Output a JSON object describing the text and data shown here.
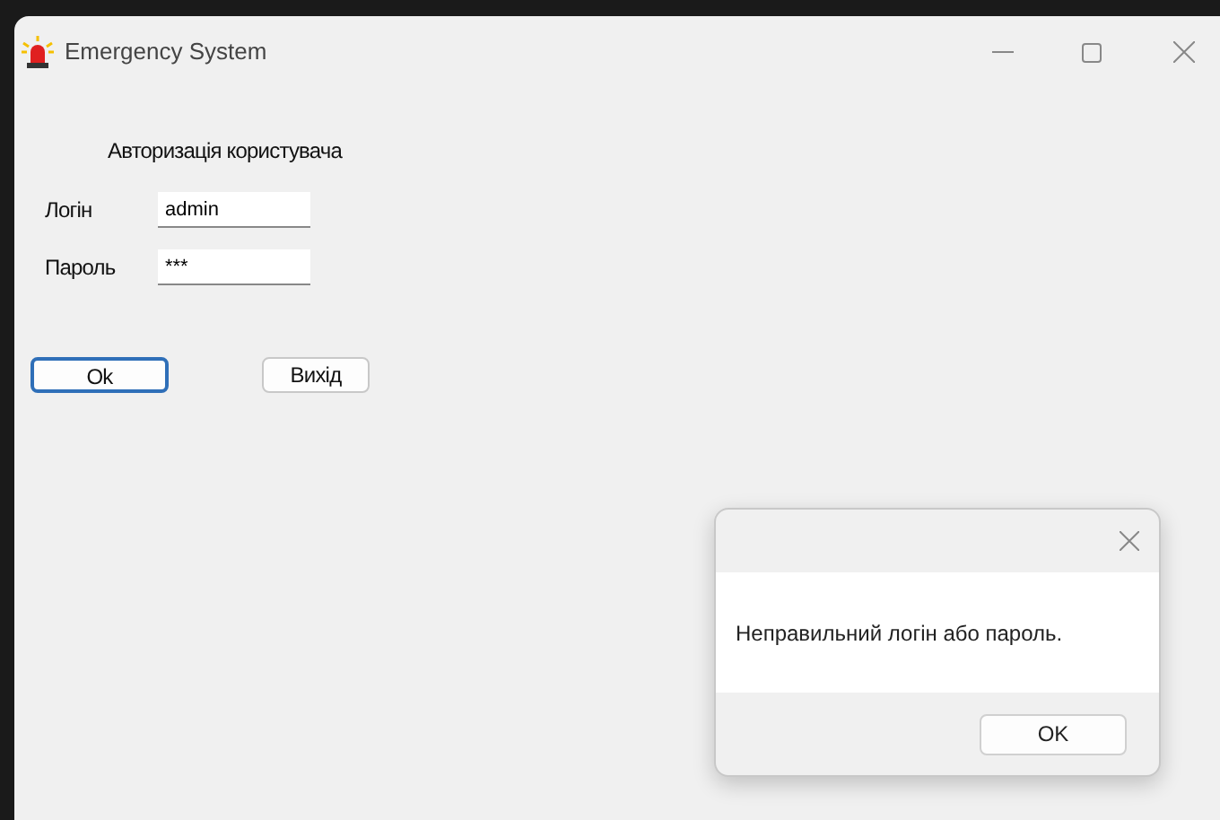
{
  "window": {
    "title": "Emergency System"
  },
  "form": {
    "heading": "Авторизація користувача",
    "fields": [
      {
        "label": "Логін",
        "value": "admin"
      },
      {
        "label": "Пароль",
        "value": "***"
      }
    ],
    "buttons": [
      {
        "label": "Ok",
        "focused": true
      },
      {
        "label": "Вихід",
        "focused": false
      }
    ]
  },
  "dialog": {
    "message": "Неправильний логін або пароль.",
    "button": "OK"
  }
}
